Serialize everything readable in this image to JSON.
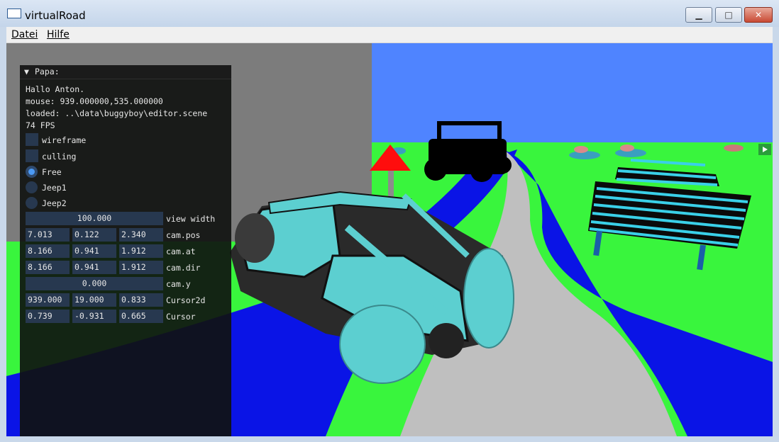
{
  "window": {
    "title": "virtualRoad",
    "minimize_glyph": "▁",
    "maximize_glyph": "□",
    "close_glyph": "✕"
  },
  "menu": {
    "file": "Datei",
    "help": "Hilfe"
  },
  "panel": {
    "collapse_glyph": "▼",
    "title": "Papa:",
    "greeting": "Hallo Anton.",
    "mouse": "mouse: 939.000000,535.000000",
    "loaded": "loaded: ..\\data\\buggyboy\\editor.scene",
    "fps": "74 FPS",
    "checkboxes": [
      {
        "label": "wireframe",
        "checked": false
      },
      {
        "label": "culling",
        "checked": false
      }
    ],
    "radios": [
      {
        "label": "Free",
        "selected": true
      },
      {
        "label": "Jeep1",
        "selected": false
      },
      {
        "label": "Jeep2",
        "selected": false
      }
    ],
    "view_width": {
      "value": "100.000",
      "label": "view width"
    },
    "cam_pos": {
      "values": [
        "7.013",
        "0.122",
        "2.340"
      ],
      "label": "cam.pos"
    },
    "cam_at": {
      "values": [
        "8.166",
        "0.941",
        "1.912"
      ],
      "label": "cam.at"
    },
    "cam_dir": {
      "values": [
        "8.166",
        "0.941",
        "1.912"
      ],
      "label": "cam.dir"
    },
    "cam_y": {
      "value": "0.000",
      "label": "cam.y"
    },
    "cursor2d": {
      "values": [
        "939.000",
        "19.000",
        "0.833"
      ],
      "label": "Cursor2d"
    },
    "cursor": {
      "values": [
        "0.739",
        "-0.931",
        "0.665"
      ],
      "label": "Cursor"
    }
  },
  "colors": {
    "sky": "#4f84ff",
    "ground": "#39f53d",
    "road": "#bfbfbf",
    "road_edge": "#0a14e6",
    "wall": "#7c7c7c",
    "jeep_paint": "#5ccfd0",
    "sign": "#ff0d0d",
    "radio_active": "#4b9af5"
  }
}
